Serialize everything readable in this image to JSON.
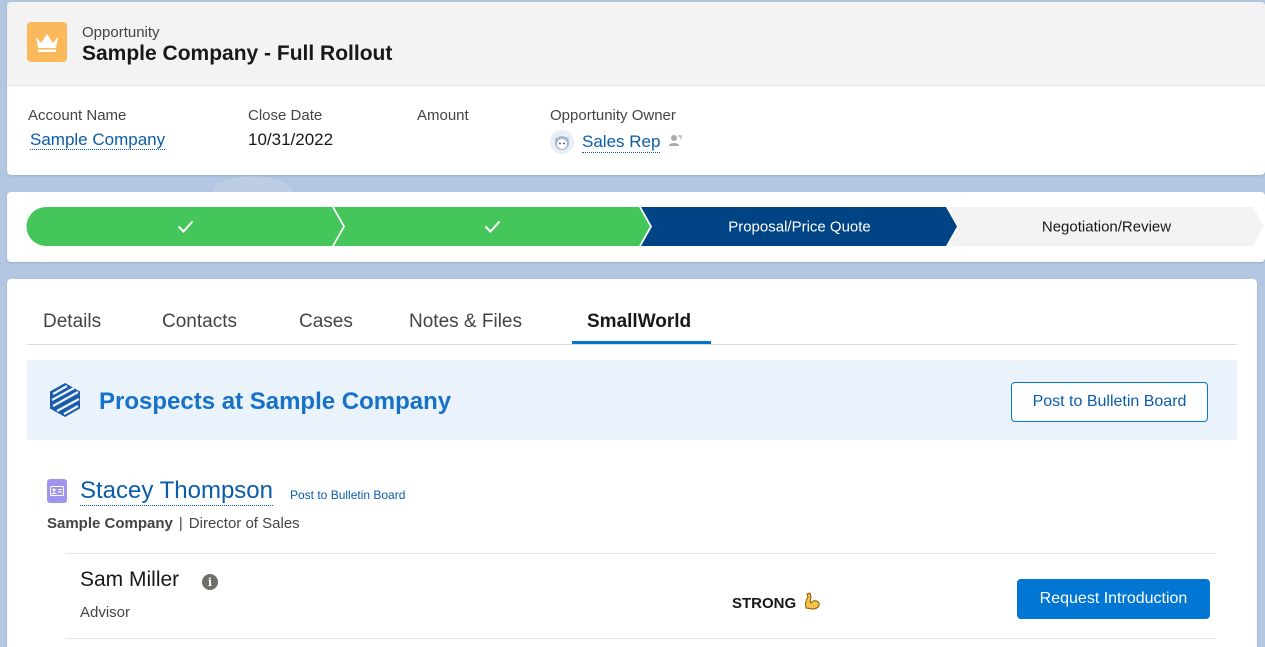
{
  "record": {
    "object_type": "Opportunity",
    "title": "Sample Company - Full Rollout"
  },
  "highlights": {
    "account_label": "Account Name",
    "account_value": "Sample Company",
    "close_date_label": "Close Date",
    "close_date_value": "10/31/2022",
    "amount_label": "Amount",
    "amount_value": "",
    "owner_label": "Opportunity Owner",
    "owner_value": "Sales Rep"
  },
  "path": {
    "stages": [
      {
        "label": "",
        "status": "complete"
      },
      {
        "label": "",
        "status": "complete"
      },
      {
        "label": "Proposal/Price Quote",
        "status": "current"
      },
      {
        "label": "Negotiation/Review",
        "status": "incomplete"
      }
    ],
    "colors": {
      "complete": "#45c65a",
      "current": "#014486",
      "incomplete": "#f3f3f3"
    }
  },
  "tabs": [
    {
      "label": "Details"
    },
    {
      "label": "Contacts"
    },
    {
      "label": "Cases"
    },
    {
      "label": "Notes & Files"
    },
    {
      "label": "SmallWorld",
      "active": true
    }
  ],
  "smallworld": {
    "banner_title": "Prospects at Sample Company",
    "post_button": "Post to Bulletin Board",
    "prospect": {
      "name": "Stacey Thompson",
      "post_link": "Post to Bulletin Board",
      "company": "Sample Company",
      "separator": "|",
      "title": "Director of Sales"
    },
    "connector": {
      "name": "Sam Miller",
      "role": "Advisor",
      "strength": "STRONG",
      "strength_icon": "flexed-biceps-icon",
      "request_button": "Request Introduction"
    }
  }
}
